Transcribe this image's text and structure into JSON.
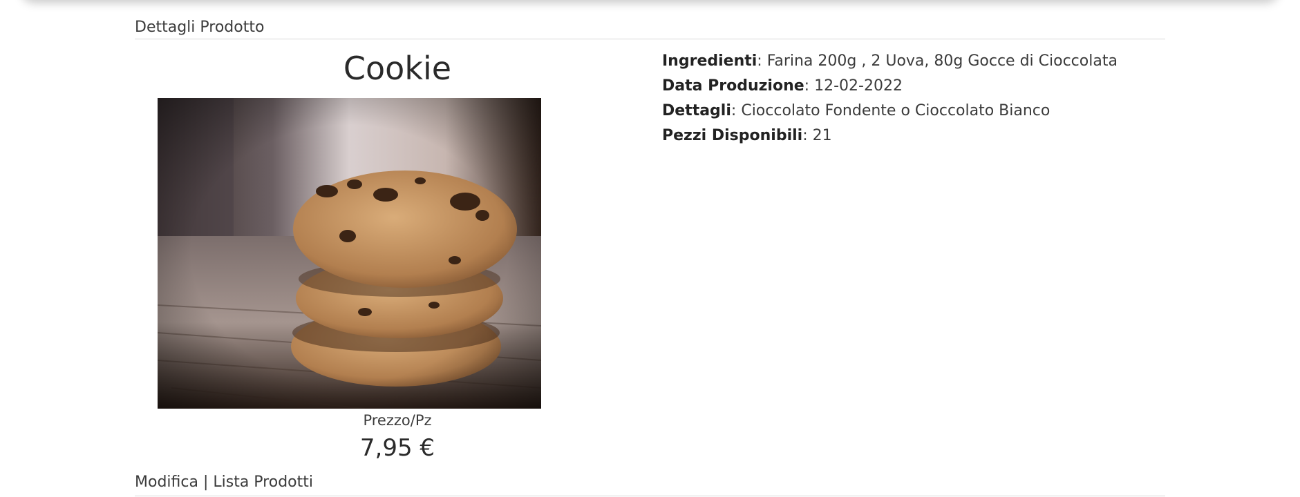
{
  "section_title": "Dettagli Prodotto",
  "product": {
    "name": "Cookie",
    "image_alt": "cookie-stack-photo",
    "price_label": "Prezzo/Pz",
    "price": "7,95 €"
  },
  "details": [
    {
      "label": "Ingredienti",
      "sep": ":",
      "value": "Farina 200g , 2 Uova, 80g Gocce di Cioccolata"
    },
    {
      "label": "Data Produzione",
      "sep": ":",
      "value": "12-02-2022"
    },
    {
      "label": "Dettagli",
      "sep": ":",
      "value": "Cioccolato Fondente o Cioccolato Bianco"
    },
    {
      "label": "Pezzi Disponibili",
      "sep": ":",
      "value": "21"
    }
  ],
  "footer": {
    "edit_link": "Modifica",
    "separator": "|",
    "list_link": "Lista Prodotti"
  }
}
